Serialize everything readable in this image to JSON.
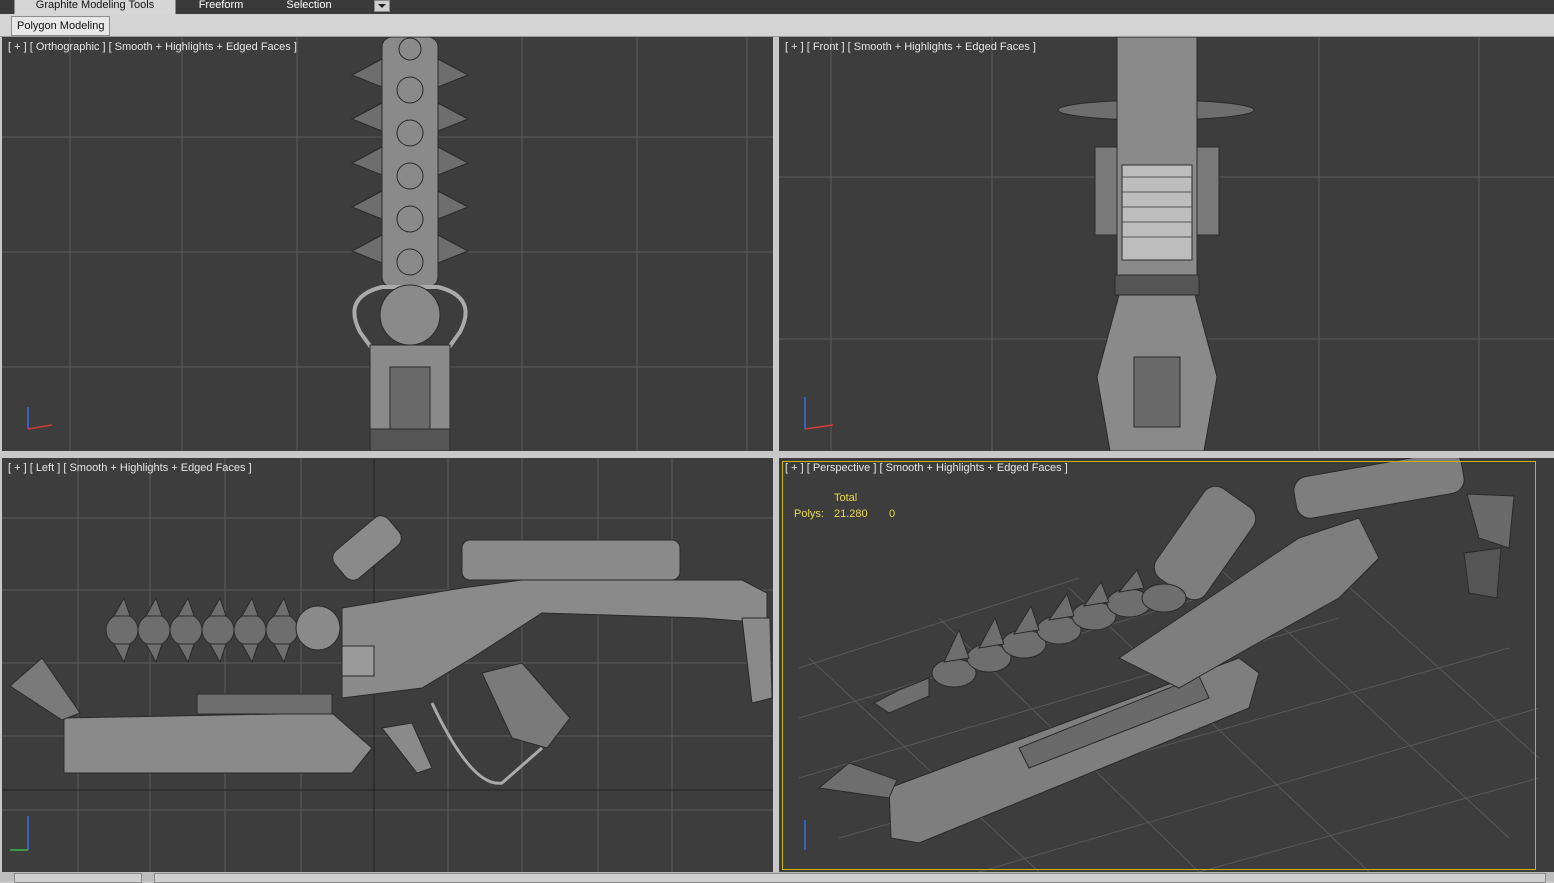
{
  "ribbon": {
    "tabs": [
      {
        "label": "Graphite Modeling Tools",
        "active": true
      },
      {
        "label": "Freeform",
        "active": false
      },
      {
        "label": "Selection",
        "active": false
      }
    ],
    "panel_button": "Polygon Modeling"
  },
  "viewports": {
    "top_left": {
      "label": "[ + ] [ Orthographic ] [ Smooth + Highlights + Edged Faces ]"
    },
    "top_right": {
      "label": "[ + ] [ Front ] [ Smooth + Highlights + Edged Faces ]"
    },
    "bottom_left": {
      "label": "[ + ] [ Left ] [ Smooth + Highlights + Edged Faces ]"
    },
    "bottom_right": {
      "label": "[ + ] [ Perspective ] [ Smooth + Highlights + Edged Faces ]",
      "stats": {
        "header": "Total",
        "polys_label": "Polys:",
        "polys_total": "21.280",
        "polys_selected": "0"
      }
    }
  },
  "colors": {
    "viewport_bg": "#3d3d3d",
    "grid_line": "#5a5a5a",
    "model_fill": "#8a8a8a",
    "active_border": "#c8b400",
    "stats_text": "#e8d84a"
  }
}
